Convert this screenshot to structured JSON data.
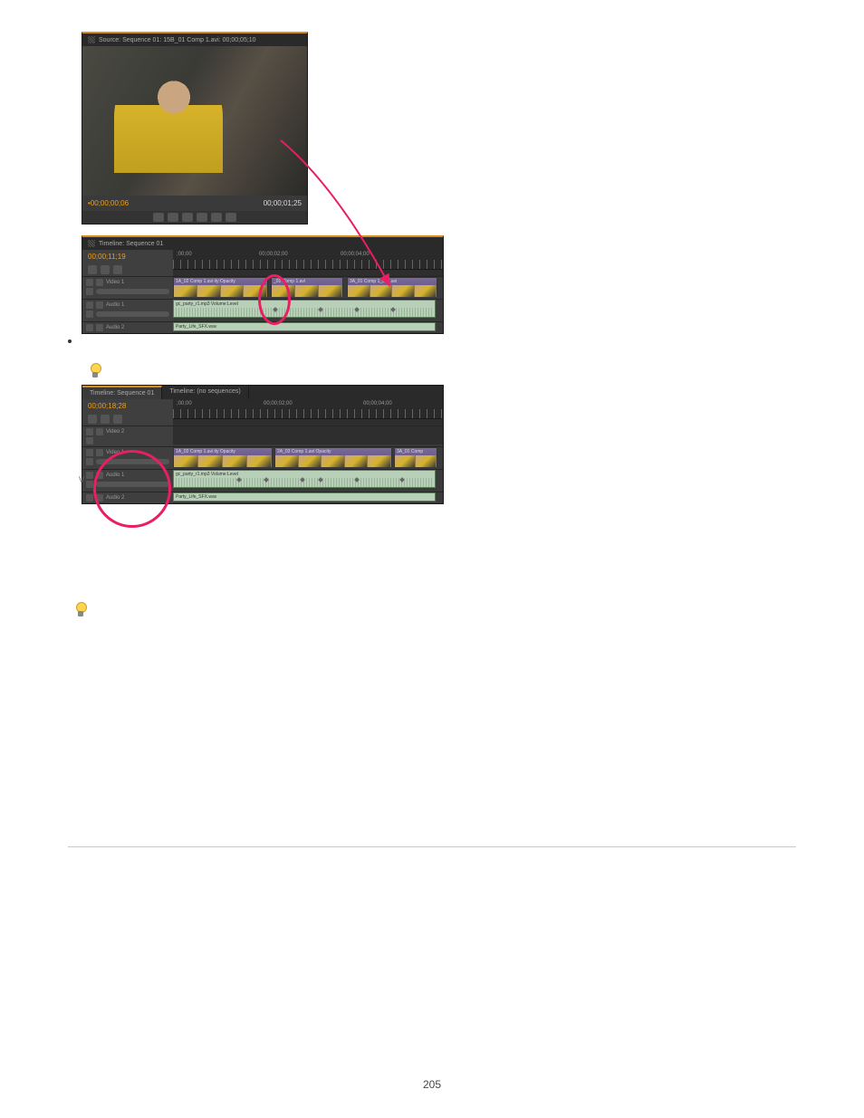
{
  "page_number": "205",
  "fig1": {
    "source_panel_title": "Source: Sequence 01: 15B_01 Comp 1.avi: 00;00;05;10",
    "tc_in": "00;00;00;06",
    "tc_out": "00;00;01;25",
    "timeline_tab": "Timeline: Sequence 01",
    "timeline_tc": "00;00;11;19",
    "ruler": {
      "t0": ";00;00",
      "t1": "00;00;02;00",
      "t2": "00;00;04;00"
    },
    "tracks": {
      "v1": "Video 1",
      "a1": "Audio 1",
      "a2": "Audio 2"
    },
    "clips": {
      "v1a": "1A_02 Comp 1.avi ity:Opacity",
      "v1b": "_01 Comp 1.avi",
      "v1c": "3A_01 Comp 1_001.avi",
      "a1": "gc_party_r1.mp3 Volume:Level",
      "a2": "Party_Life_SFX.wav"
    }
  },
  "fig2": {
    "tab_active": "Timeline: Sequence 01",
    "tab_inactive": "Timeline: (no sequences)",
    "timeline_tc": "00;00;18;28",
    "ruler": {
      "t0": ";00;00",
      "t1": "00;00;02;00",
      "t2": "00;00;04;00"
    },
    "tracks": {
      "v2": "Video 2",
      "v1": "Video 1",
      "a1": "Audio 1",
      "a2": "Audio 2"
    },
    "clips": {
      "v1a": "1A_02 Comp 1.avi ity Opacity",
      "v1b": "2A_03 Comp 1.avi Opacity",
      "v1c": "3A_01 Comp",
      "a1": "gc_party_r1.mp3 Volume:Level",
      "a2": "Party_Life_SFX.wav"
    }
  }
}
